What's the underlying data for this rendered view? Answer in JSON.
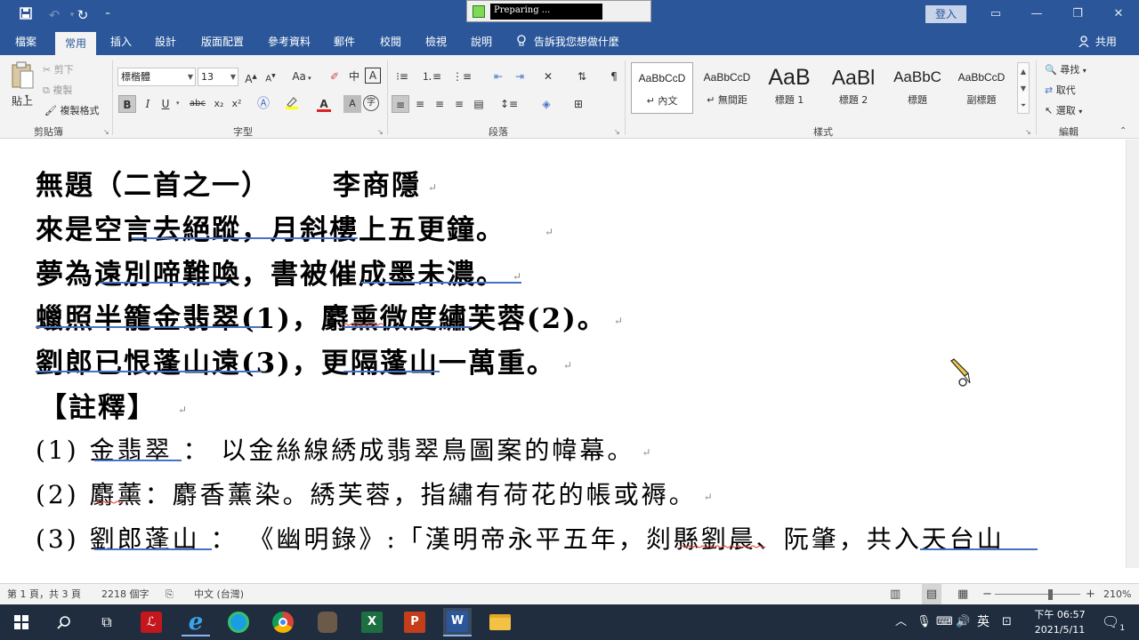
{
  "titlebar": {
    "preparing_text": "Preparing ...",
    "signin_label": "登入",
    "minimize_glyph": "—",
    "restore_glyph": "❐",
    "close_glyph": "✕",
    "ribbon_display_glyph": "▭"
  },
  "tabs": [
    "檔案",
    "常用",
    "插入",
    "設計",
    "版面配置",
    "參考資料",
    "郵件",
    "校閱",
    "檢視",
    "說明"
  ],
  "active_tab": "常用",
  "tell_me": "告訴我您想做什麼",
  "share_label": "共用",
  "clipboard": {
    "paste_label": "貼上",
    "cut_label": "剪下",
    "copy_label": "複製",
    "format_painter_label": "複製格式",
    "group_label": "剪貼簿"
  },
  "font": {
    "font_name": "標楷體",
    "font_size": "13",
    "group_label": "字型",
    "grow_glyph": "A",
    "shrink_glyph": "A",
    "case_glyph": "Aa",
    "bold_glyph": "B",
    "italic_glyph": "I",
    "underline_glyph": "U",
    "strike_glyph": "abc",
    "subscript_glyph": "x₂",
    "superscript_glyph": "x²",
    "phonetic_glyph": "中",
    "border_char_glyph": "A",
    "font_color_glyph": "A",
    "shading_glyph": "A",
    "enclose_glyph": "字"
  },
  "paragraph": {
    "group_label": "段落"
  },
  "styles": {
    "group_label": "樣式",
    "items": [
      {
        "preview": "AaBbCcD",
        "name": "↵ 內文"
      },
      {
        "preview": "AaBbCcD",
        "name": "↵ 無間距"
      },
      {
        "preview": "AaB",
        "name": "標題 1"
      },
      {
        "preview": "AaBl",
        "name": "標題 2"
      },
      {
        "preview": "AaBbC",
        "name": "標題"
      },
      {
        "preview": "AaBbCcD",
        "name": "副標題"
      }
    ]
  },
  "editing": {
    "group_label": "編輯",
    "find_label": "尋找",
    "replace_label": "取代",
    "select_label": "選取"
  },
  "document": {
    "title": "無題（二首之一）",
    "author": "李商隱",
    "lines": [
      "來是空言去絕蹤，月斜樓上五更鐘。",
      "夢為遠別啼難喚，書被催成墨未濃。",
      "蠟照半籠金翡翠(1)，麝熏微度繡芙蓉(2)。",
      "劉郎已恨蓬山遠(3)，更隔蓬山一萬重。"
    ],
    "notes_heading": "【註釋】",
    "notes": [
      "(1) 金翡翠 ： 以金絲線綉成翡翠鳥圖案的幃幕。",
      "(2) 麝薰：麝香薰染。綉芙蓉，指繡有荷花的帳或褥。",
      "(3) 劉郎蓬山 ： 《幽明錄》:「漢明帝永平五年，剡縣劉晨、阮肇，共入天台山"
    ],
    "para_mark": "↵"
  },
  "status": {
    "page": "第 1 頁，共 3 頁",
    "words": "2218 個字",
    "language": "中文 (台灣)",
    "zoom": "210%",
    "zoom_minus": "−",
    "zoom_plus": "+"
  },
  "taskbar": {
    "ime_label": "英",
    "time": "下午 06:57",
    "date": "2021/5/11",
    "notification_count": "1"
  }
}
